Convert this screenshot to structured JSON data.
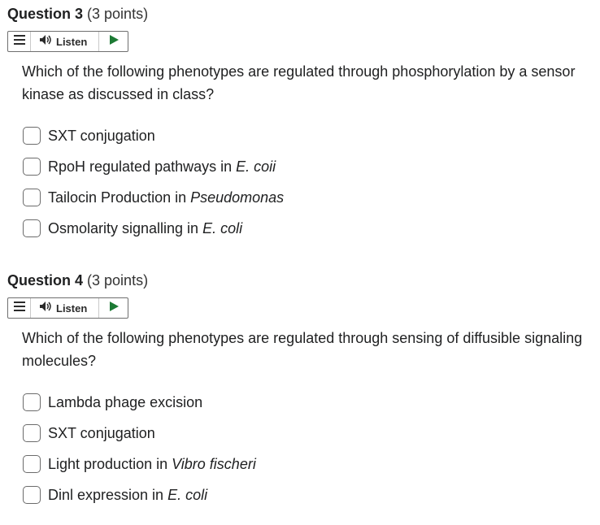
{
  "questions": [
    {
      "name": "Question 3",
      "points": "(3 points)",
      "listen_label": "Listen",
      "text": "Which of the following phenotypes are regulated through phosphorylation by a sensor kinase as discussed in class?",
      "options": [
        {
          "plain": "SXT conjugation",
          "italic": ""
        },
        {
          "plain": "RpoH regulated pathways in ",
          "italic": "E. coii"
        },
        {
          "plain": "Tailocin Production in ",
          "italic": "Pseudomonas"
        },
        {
          "plain": "Osmolarity signalling in ",
          "italic": "E. coli"
        }
      ]
    },
    {
      "name": "Question 4",
      "points": "(3 points)",
      "listen_label": "Listen",
      "text": "Which of the following phenotypes are regulated through sensing of diffusible signaling molecules?",
      "options": [
        {
          "plain": "Lambda phage excision",
          "italic": ""
        },
        {
          "plain": "SXT conjugation",
          "italic": ""
        },
        {
          "plain": "Light production in ",
          "italic": "Vibro fischeri"
        },
        {
          "plain": "Dinl expression in ",
          "italic": "E. coli"
        }
      ]
    }
  ],
  "icons": {
    "menu": "menu-icon",
    "speaker": "speaker-icon",
    "play": "play-icon"
  },
  "colors": {
    "play_green": "#1c7a34",
    "text": "#202122"
  }
}
